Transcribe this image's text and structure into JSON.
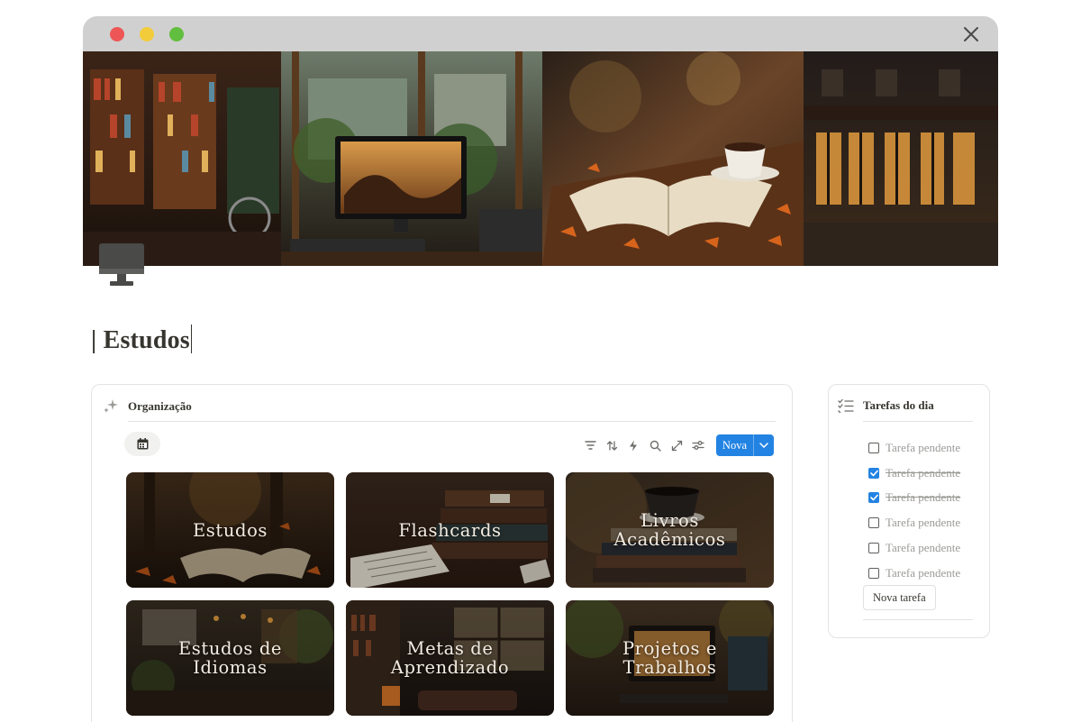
{
  "page": {
    "title": "| Estudos",
    "icon": "desktop-computer-icon"
  },
  "colors": {
    "accent": "#2383e2",
    "titlebar": "#d0d0d0",
    "text": "#37352f",
    "muted": "#9b9a97"
  },
  "organizacao": {
    "title": "Organização",
    "icon": "sparkles-icon",
    "view_icon": "calendar-icon",
    "toolbar_icons": [
      "filter-icon",
      "sort-icon",
      "lightning-icon",
      "search-icon",
      "expand-icon",
      "settings-sliders-icon"
    ],
    "new_button_label": "Nova",
    "cards": [
      {
        "title": "Estudos"
      },
      {
        "title": "Flashcards"
      },
      {
        "title": "Livros\nAcadêmicos"
      },
      {
        "title": "Estudos de\nIdiomas"
      },
      {
        "title": "Metas de\nAprendizado"
      },
      {
        "title": "Projetos e\nTrabalhos"
      }
    ]
  },
  "tarefas": {
    "title": "Tarefas do dia",
    "icon": "checklist-icon",
    "items": [
      {
        "label": "Tarefa pendente",
        "done": false
      },
      {
        "label": "Tarefa pendente",
        "done": true
      },
      {
        "label": "Tarefa pendente",
        "done": true
      },
      {
        "label": "Tarefa pendente",
        "done": false
      },
      {
        "label": "Tarefa pendente",
        "done": false
      },
      {
        "label": "Tarefa pendente",
        "done": false
      }
    ],
    "new_task_label": "Nova tarefa"
  }
}
